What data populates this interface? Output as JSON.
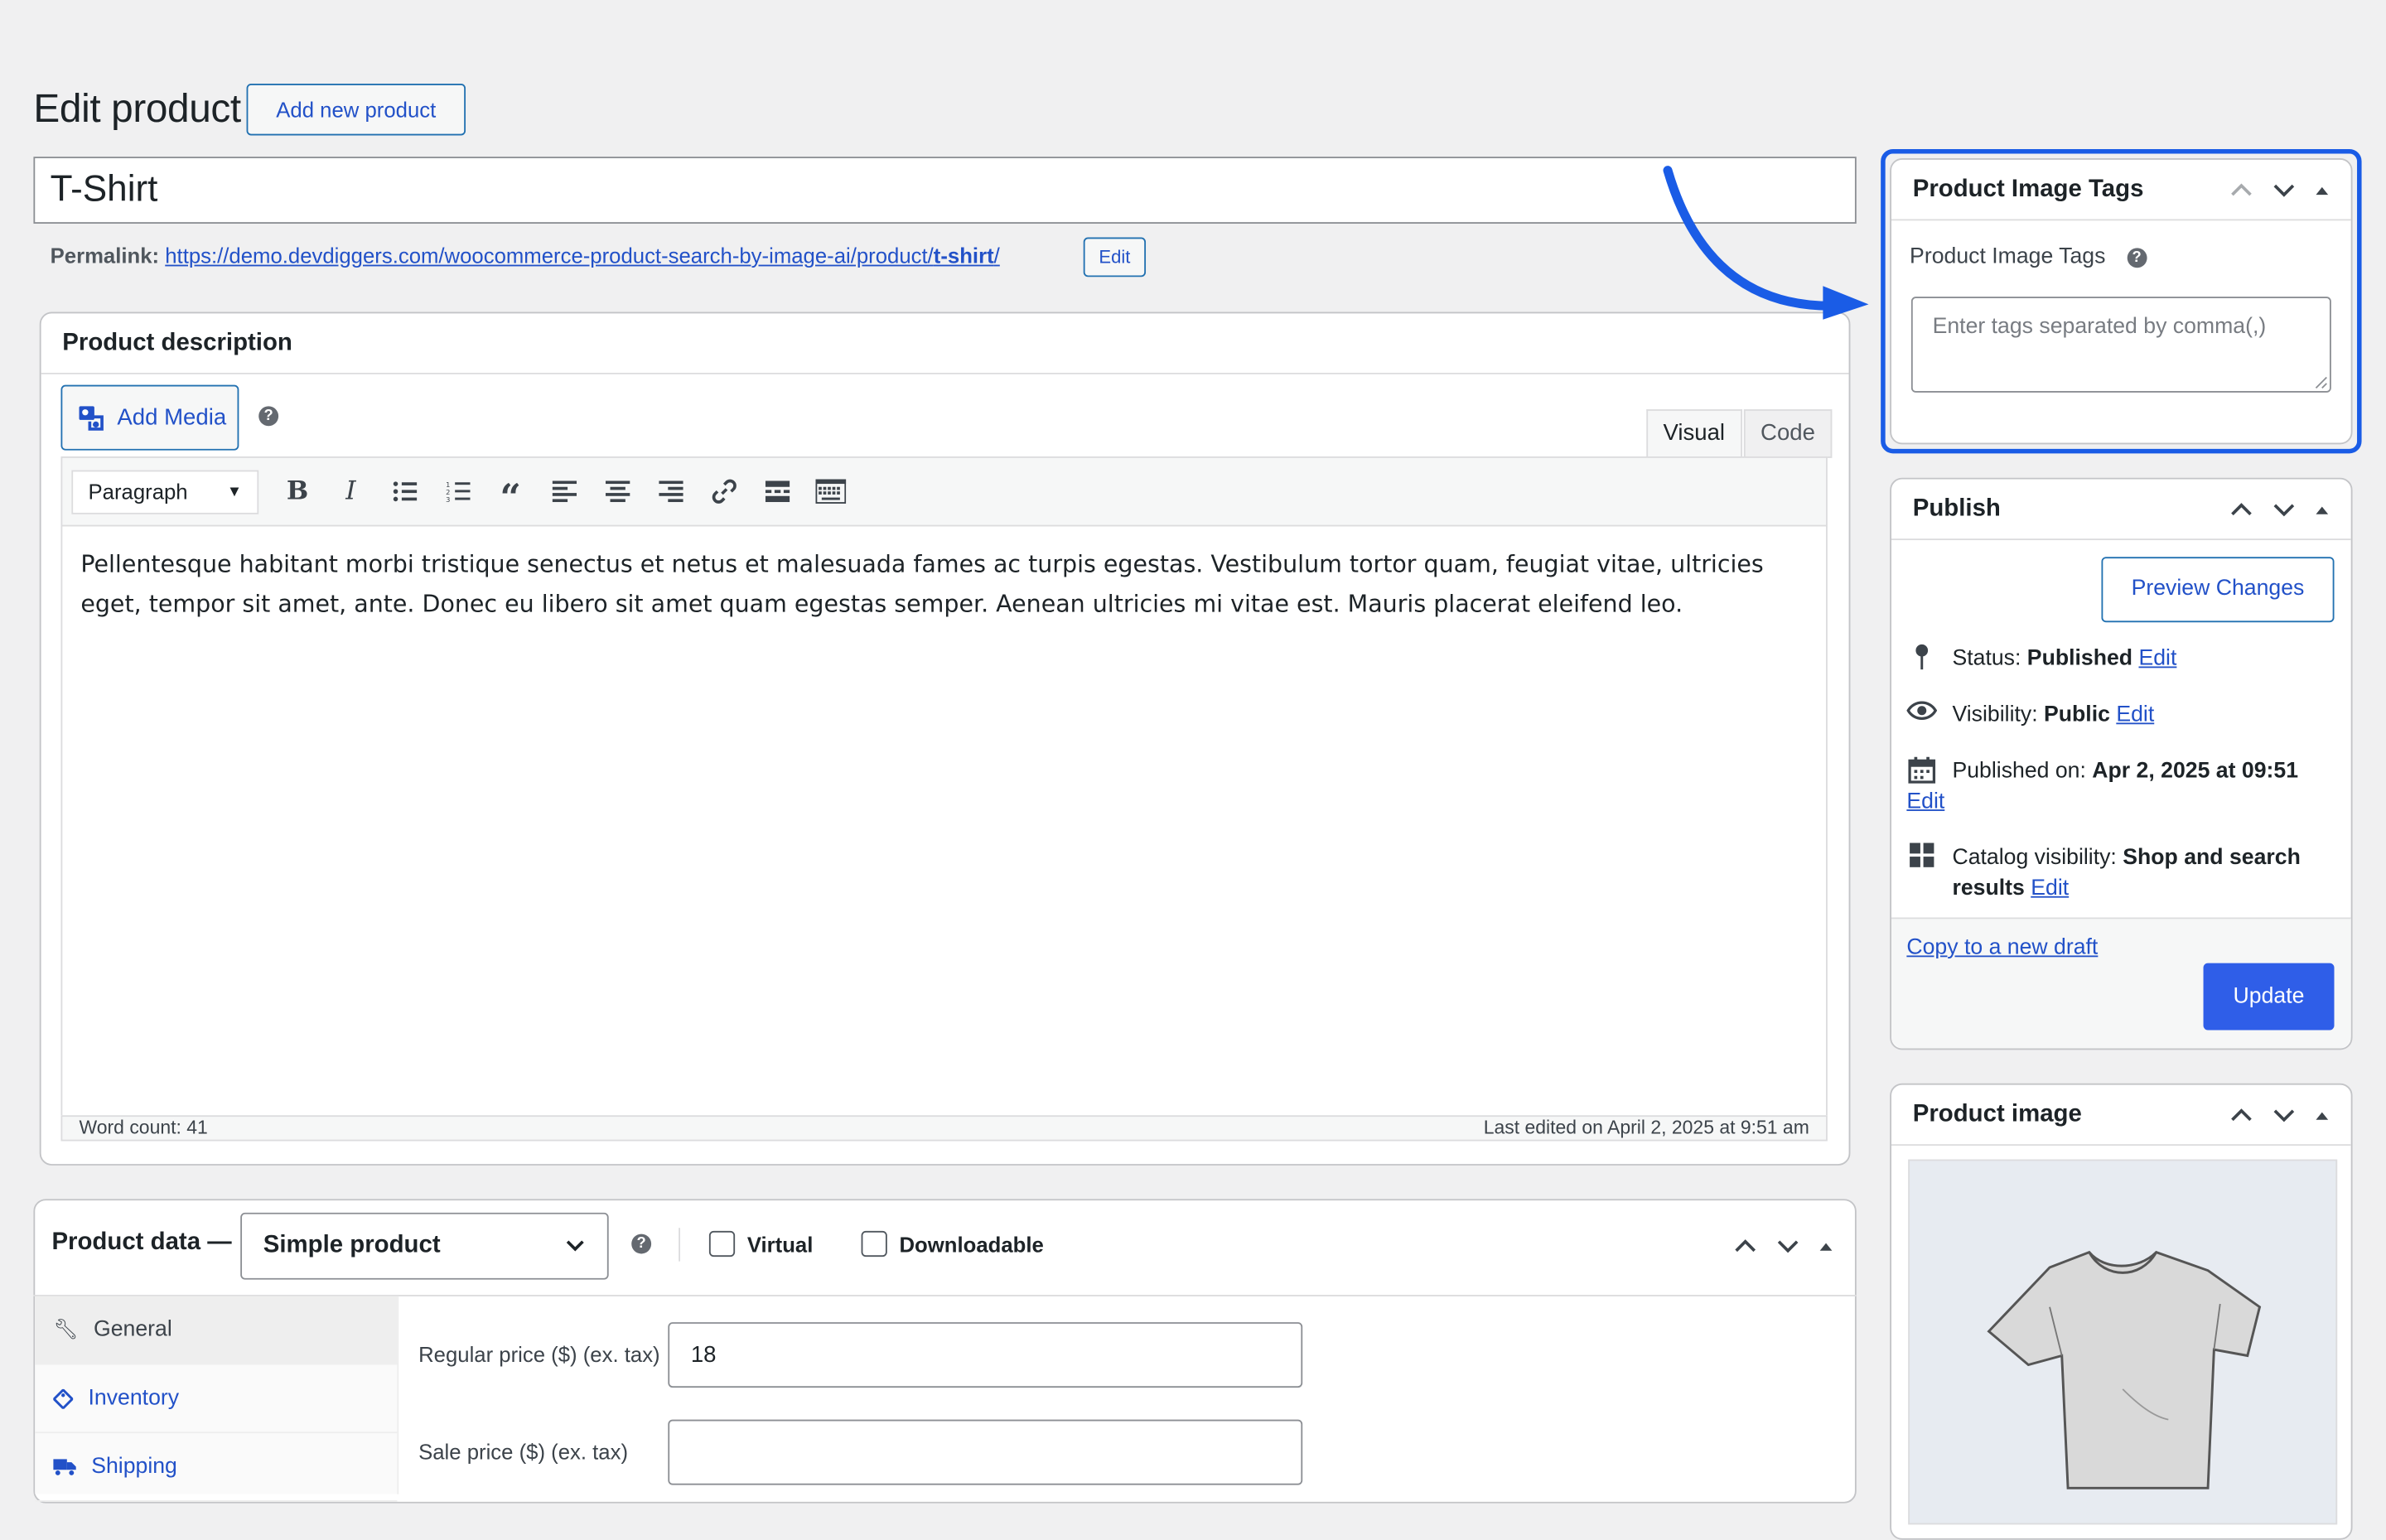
{
  "header": {
    "title": "Edit product",
    "add_new_label": "Add new product"
  },
  "product": {
    "title": "T-Shirt",
    "permalink_label": "Permalink:",
    "permalink_base": "https://demo.devdiggers.com/woocommerce-product-search-by-image-ai/product/",
    "permalink_slug": "t-shirt",
    "permalink_trailing": "/",
    "permalink_edit_label": "Edit"
  },
  "description": {
    "heading": "Product description",
    "add_media_label": "Add Media",
    "help_glyph": "?",
    "tabs": [
      {
        "label": "Visual",
        "active": true
      },
      {
        "label": "Code",
        "active": false
      }
    ],
    "format_select": "Paragraph",
    "toolbar_buttons": [
      "bold",
      "italic",
      "bullet-list",
      "numbered-list",
      "blockquote",
      "align-left",
      "align-center",
      "align-right",
      "link",
      "read-more",
      "toolbar-toggle"
    ],
    "content": "Pellentesque habitant morbi tristique senectus et netus et malesuada fames ac turpis egestas. Vestibulum tortor quam, feugiat vitae, ultricies eget, tempor sit amet, ante. Donec eu libero sit amet quam egestas semper. Aenean ultricies mi vitae est. Mauris placerat eleifend leo.",
    "word_count": "Word count: 41",
    "last_edited": "Last edited on April 2, 2025 at 9:51 am"
  },
  "product_data": {
    "label": "Product data —",
    "type_value": "Simple product",
    "help_glyph": "?",
    "virtual_label": "Virtual",
    "virtual_checked": false,
    "downloadable_label": "Downloadable",
    "downloadable_checked": false,
    "tabs": [
      {
        "label": "General",
        "icon": "wrench-icon",
        "active": true
      },
      {
        "label": "Inventory",
        "icon": "tag-icon",
        "active": false
      },
      {
        "label": "Shipping",
        "icon": "truck-icon",
        "active": false
      }
    ],
    "regular_price_label": "Regular price ($) (ex. tax)",
    "regular_price_value": "18",
    "sale_price_label": "Sale price ($) (ex. tax)",
    "sale_price_value": ""
  },
  "image_tags": {
    "heading": "Product Image Tags",
    "field_label": "Product Image Tags",
    "help_glyph": "?",
    "placeholder": "Enter tags separated by comma(,)",
    "highlight_color": "#1a5ce6"
  },
  "publish": {
    "heading": "Publish",
    "preview_label": "Preview Changes",
    "status_label": "Status:",
    "status_value": "Published",
    "visibility_label": "Visibility:",
    "visibility_value": "Public",
    "published_label": "Published on:",
    "published_value": "Apr 2, 2025 at 09:51",
    "catalog_label": "Catalog visibility:",
    "catalog_value": "Shop and search results",
    "edit_label": "Edit",
    "copy_draft_label": "Copy to a new draft",
    "update_label": "Update",
    "update_color": "#2f5ee8"
  },
  "product_image": {
    "heading": "Product image"
  }
}
